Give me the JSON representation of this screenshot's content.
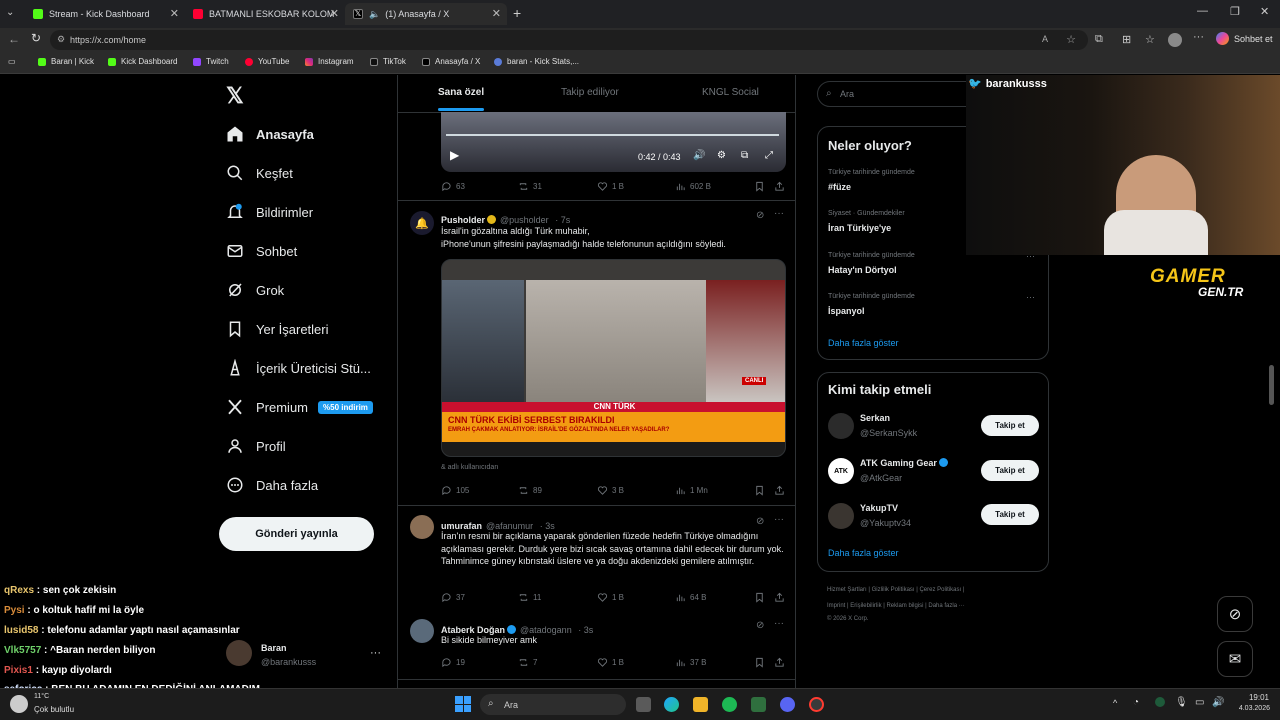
{
  "browser": {
    "tabs": [
      {
        "title": "Stream - Kick Dashboard",
        "active": false
      },
      {
        "title": "BATMANLI ESKOBAR KOLOMBİYA",
        "active": false
      },
      {
        "title": "(1) Anasayfa / X",
        "active": true
      }
    ],
    "url": "https://x.com/home",
    "profile_label": "Sohbet et",
    "bookmarks": [
      "Baran | Kick",
      "Kick Dashboard",
      "Twitch",
      "YouTube",
      "Instagram",
      "TikTok",
      "Anasayfa / X",
      "baran - Kick Stats,..."
    ]
  },
  "sidebar": {
    "items": [
      {
        "label": "Anasayfa",
        "icon": "home-icon"
      },
      {
        "label": "Keşfet",
        "icon": "search-icon"
      },
      {
        "label": "Bildirimler",
        "icon": "bell-icon",
        "badge": "1"
      },
      {
        "label": "Sohbet",
        "icon": "mail-icon"
      },
      {
        "label": "Grok",
        "icon": "grok-icon"
      },
      {
        "label": "Yer İşaretleri",
        "icon": "bookmark-icon"
      },
      {
        "label": "İçerik Üreticisi Stü...",
        "icon": "creator-icon"
      },
      {
        "label": "Premium",
        "icon": "x-icon",
        "badge": "%50 indirim"
      },
      {
        "label": "Profil",
        "icon": "profile-icon"
      },
      {
        "label": "Daha fazla",
        "icon": "more-icon"
      }
    ],
    "post_button": "Gönderi yayınla",
    "account": {
      "name": "Baran",
      "handle": "@barankusss"
    }
  },
  "feed": {
    "tabs": [
      "Sana özel",
      "Takip ediliyor",
      "KNGL Social"
    ],
    "video_time": "0:42 / 0:43",
    "tweet0_actions": {
      "replies": "63",
      "retweets": "31",
      "likes": "1 B",
      "views": "602 B"
    },
    "tweets": [
      {
        "name": "Pusholder",
        "handle": "@pusholder",
        "time": "7s",
        "text_line1": "İsrail'in gözaltına aldığı Türk muhabir,",
        "text_line2": "iPhone'unun şifresini paylaşmadığı halde telefonunun açıldığını söyledi.",
        "media_caption": "adlı kullanıcıdan",
        "media_headline": "CNN TÜRK EKİBİ SERBEST BIRAKILDI",
        "media_subheadline": "EMRAH ÇAKMAK ANLATIYOR: İSRAİL'DE GÖZALTINDA NELER YAŞADILAR?",
        "media_brand": "CNN TÜRK",
        "media_live": "CANLI",
        "actions": {
          "replies": "105",
          "retweets": "89",
          "likes": "3 B",
          "views": "1 Mn"
        }
      },
      {
        "name": "umurafan",
        "handle": "@afanumur",
        "time": "3s",
        "text": "İran'ın resmi bir açıklama yaparak gönderilen füzede hedefin Türkiye olmadığını açıklaması gerekir. Durduk yere bizi sıcak savaş ortamına dahil edecek bir durum yok. Tahminimce güney kıbrıstaki üslere ve ya doğu akdenizdeki gemilere atılmıştır.",
        "actions": {
          "replies": "37",
          "retweets": "11",
          "likes": "1 B",
          "views": "64 B"
        }
      },
      {
        "name": "Ataberk Doğan",
        "handle": "@atadogann",
        "time": "3s",
        "text": "Bi sikide bilmeyiver amk",
        "actions": {
          "replies": "19",
          "retweets": "7",
          "likes": "1 B",
          "views": "37 B"
        }
      }
    ]
  },
  "right": {
    "search_placeholder": "Ara",
    "trends_title": "Neler oluyor?",
    "trends": [
      {
        "meta": "Türkiye tarihinde gündemde",
        "name": "#füze"
      },
      {
        "meta": "Siyaset · Gündemdekiler",
        "name": "İran Türkiye'ye"
      },
      {
        "meta": "Türkiye tarihinde gündemde",
        "name": "Hatay'ın Dörtyol"
      },
      {
        "meta": "Türkiye tarihinde gündemde",
        "name": "İspanyol"
      }
    ],
    "trends_more": "Daha fazla göster",
    "who_title": "Kimi takip etmeli",
    "who": [
      {
        "name": "Serkan",
        "handle": "@SerkanSykk"
      },
      {
        "name": "ATK Gaming Gear",
        "handle": "@AtkGear"
      },
      {
        "name": "YakupTV",
        "handle": "@Yakuptv34"
      }
    ],
    "follow_label": "Takip et",
    "who_more": "Daha fazla göster",
    "footer_line1": "Hizmet Şartları  |  Gizlilik Politikası  |  Çerez Politikası  |",
    "footer_line2": "Imprint  |  Erişilebilirlik  |  Reklam bilgisi  |  Daha fazla ···",
    "footer_line3": "© 2026 X Corp."
  },
  "overlay": {
    "twitter_handle": "barankusss",
    "brand_top": "GAMER",
    "brand_bottom": "GEN.TR",
    "chat": [
      {
        "user": "qRexs",
        "msg": "sen çok zekisin",
        "color": "#e8c56d"
      },
      {
        "user": "Pysi",
        "msg": "o koltuk hafif mi la öyle",
        "color": "#d98c3a"
      },
      {
        "user": "lusid58",
        "msg": "telefonu adamlar yaptı nasıl açamasınlar",
        "color": "#e8c56d"
      },
      {
        "user": "Vlk5757",
        "msg": "^Baran nerden biliyon",
        "color": "#6fd06a"
      },
      {
        "user": "Pixis1",
        "msg": "kayıp diyolardı",
        "color": "#e0564f"
      },
      {
        "user": "seforicc",
        "msg": "BEN BU ADAMIN EN DEDİĞİNİ ANLAMADIM",
        "color": "#d6e4ff"
      }
    ]
  },
  "taskbar": {
    "weather_temp": "11°C",
    "weather_desc": "Çok bulutlu",
    "search": "Ara",
    "time": "19:01",
    "date": "4.03.2026"
  }
}
